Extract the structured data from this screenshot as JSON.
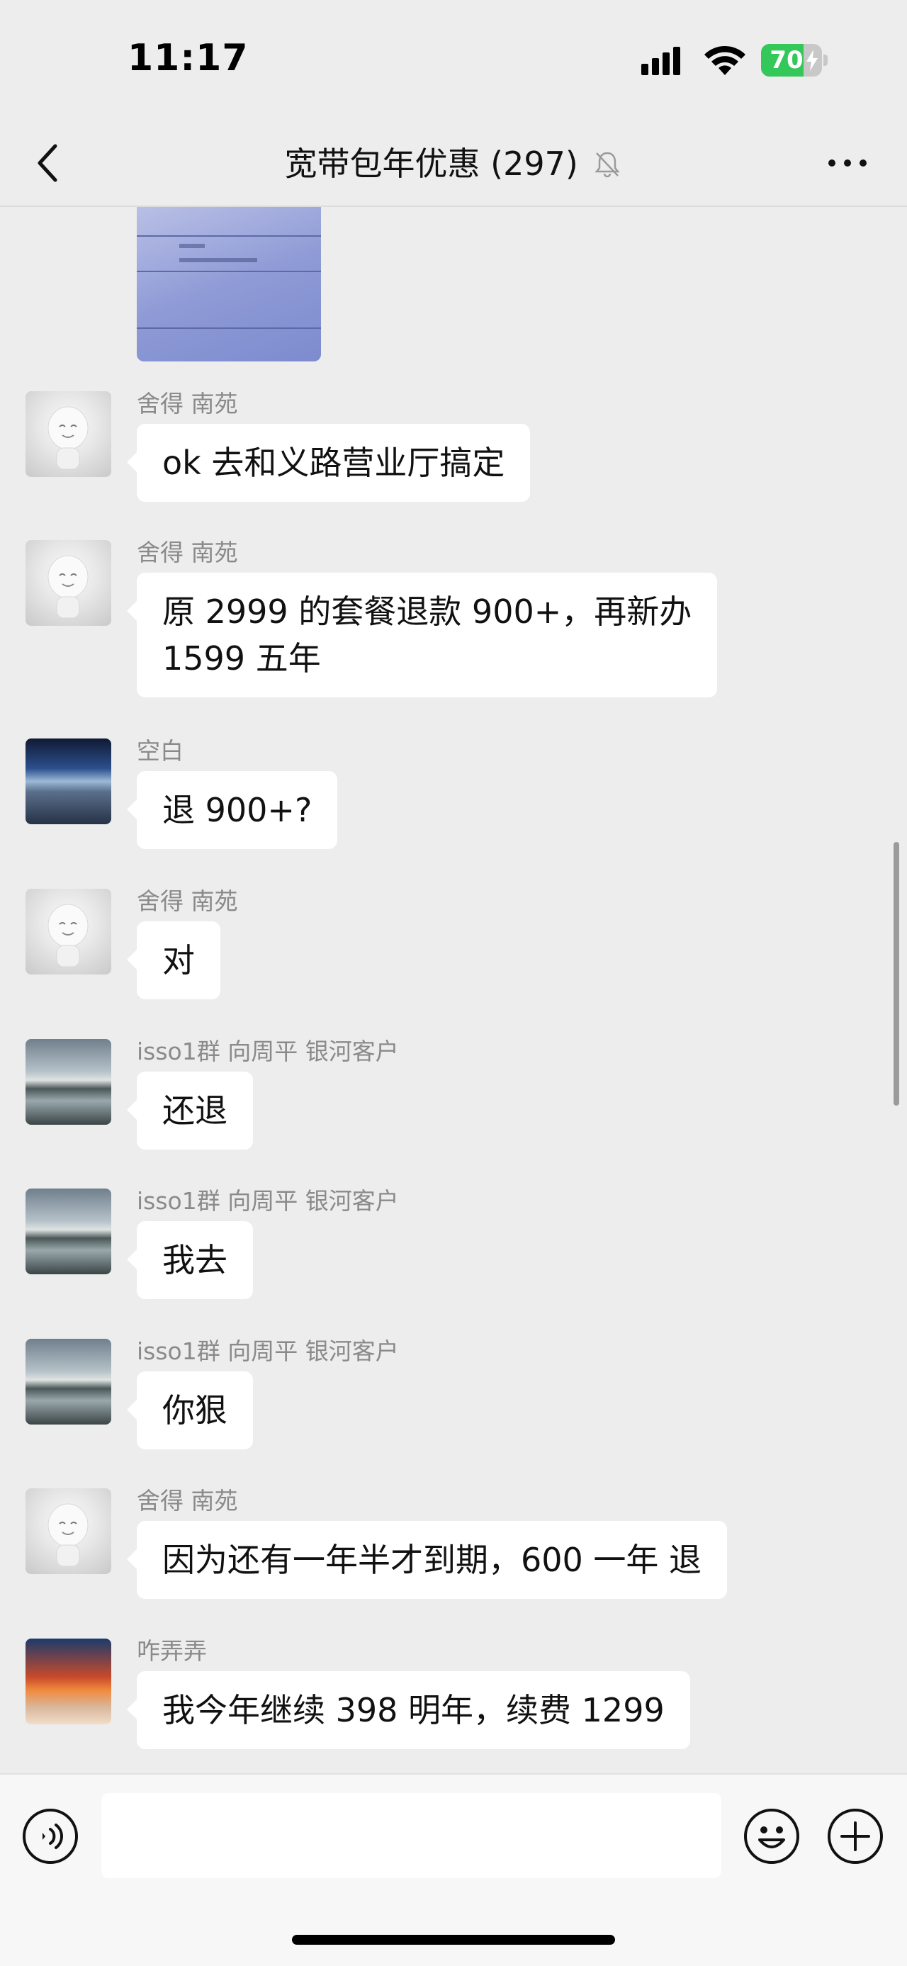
{
  "status_bar": {
    "time": "11:17",
    "battery_level": "70",
    "battery_fraction": 0.7,
    "battery_color": "#34c759"
  },
  "nav": {
    "title": "宽带包年优惠 (297)",
    "back_icon": "chevron-left-icon",
    "mute_icon": "bell-muted-icon",
    "more_icon": "more-dots-icon"
  },
  "messages": [
    {
      "sender": "舍得   南苑",
      "text": "ok 去和义路营业厅搞定",
      "avatar": "baozi-avatar"
    },
    {
      "sender": "舍得   南苑",
      "text": "原 2999 的套餐退款 900+，再新办\n1599 五年",
      "avatar": "baozi-avatar"
    },
    {
      "sender": "空白",
      "text": "退 900+?",
      "avatar": "lake-avatar"
    },
    {
      "sender": "舍得   南苑",
      "text": "对",
      "avatar": "baozi-avatar"
    },
    {
      "sender": "isso1群 向周平 银河客户",
      "text": "还退",
      "avatar": "sky-avatar"
    },
    {
      "sender": "isso1群 向周平 银河客户",
      "text": "我去",
      "avatar": "sky-avatar"
    },
    {
      "sender": "isso1群 向周平 银河客户",
      "text": "你狠",
      "avatar": "sky-avatar"
    },
    {
      "sender": "舍得   南苑",
      "text": "因为还有一年半才到期，600 一年 退",
      "avatar": "baozi-avatar"
    },
    {
      "sender": "咋弄弄",
      "text": "我今年继续 398 明年，续费 1299",
      "avatar": "sunset-avatar"
    }
  ],
  "input_bar": {
    "placeholder": "",
    "voice_icon": "voice-icon",
    "emoji_icon": "emoji-icon",
    "plus_icon": "plus-icon"
  }
}
